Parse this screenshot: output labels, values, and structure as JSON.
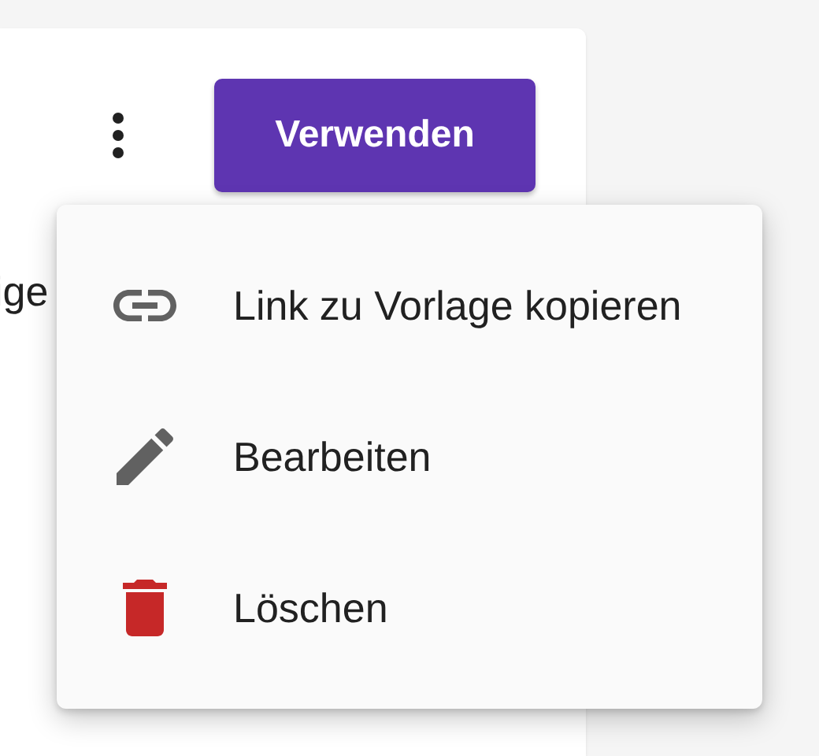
{
  "card": {
    "primary_button": "Verwenden",
    "text_fragment": "ige"
  },
  "menu": {
    "items": [
      {
        "kind": "link",
        "label": "Link zu Vorlage kopieren"
      },
      {
        "kind": "edit",
        "label": "Bearbeiten"
      },
      {
        "kind": "delete",
        "label": "Löschen"
      }
    ]
  }
}
